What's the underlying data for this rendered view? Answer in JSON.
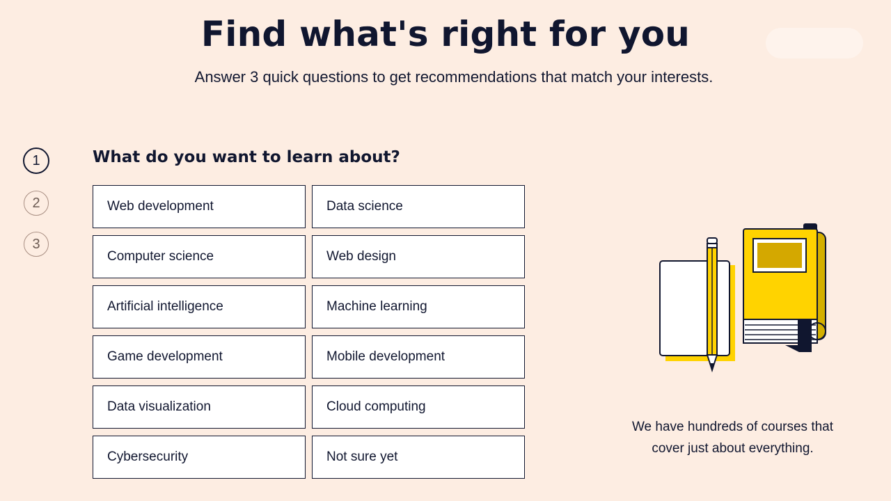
{
  "header": {
    "title": "Find what's right for you",
    "subtitle": "Answer 3 quick questions to get recommendations that match your interests."
  },
  "steps": [
    "1",
    "2",
    "3"
  ],
  "current_step": 1,
  "question": {
    "text": "What do you want to learn about?",
    "options": [
      "Web development",
      "Data science",
      "Computer science",
      "Web design",
      "Artificial intelligence",
      "Machine learning",
      "Game development",
      "Mobile development",
      "Data visualization",
      "Cloud computing",
      "Cybersecurity",
      "Not sure yet"
    ]
  },
  "side_panel": {
    "text_line1": "We have hundreds of courses that",
    "text_line2": "cover just about everything."
  },
  "colors": {
    "background": "#fdede2",
    "text": "#10162f",
    "accent_yellow": "#ffd300"
  }
}
